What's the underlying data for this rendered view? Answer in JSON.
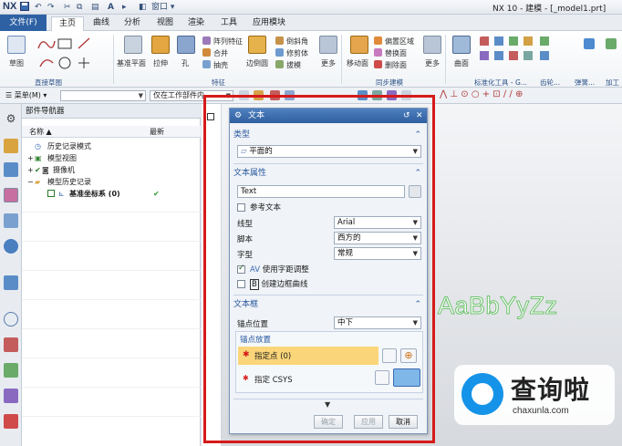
{
  "app": {
    "logo": "NX",
    "title": "NX 10 - 建模 - [_model1.prt]",
    "window_menu": "窗口"
  },
  "tabs": {
    "file": "文件(F)",
    "items": [
      "主页",
      "曲线",
      "分析",
      "视图",
      "渲染",
      "工具",
      "应用模块"
    ],
    "active": "主页"
  },
  "ribbon": {
    "sketch": "草图",
    "direct_sketch_group": "直接草图",
    "datum_plane": "基准平面",
    "extrude": "拉伸",
    "hole": "孔",
    "pattern_feature": "阵列特征",
    "unite": "合并",
    "shell": "抽壳",
    "edge_blend": "边倒圆",
    "chamfer": "倒斜角",
    "trim_body": "修剪体",
    "draft": "拔模",
    "more1": "更多",
    "feature_group": "特征",
    "move_face": "移动面",
    "offset_region": "偏置区域",
    "replace_face": "替换面",
    "delete_face": "删除面",
    "more2": "更多",
    "sync_group": "同步建模",
    "surface": "曲面",
    "standard_tools_group": "标准化工具 - G...",
    "gear_group": "齿轮...",
    "spring_group": "弹簧...",
    "process_group": "加工"
  },
  "toolbar2": {
    "menu_label": "菜单(M)",
    "filter_value": "",
    "scope_value": "仅在工作部件内"
  },
  "navigator": {
    "title": "部件导航器",
    "col_name": "名称",
    "col_latest": "最新",
    "rows": [
      {
        "label": "历史记录模式",
        "check": ""
      },
      {
        "label": "模型视图",
        "check": ""
      },
      {
        "label": "摄像机",
        "check": ""
      },
      {
        "label": "模型历史记录",
        "check": ""
      },
      {
        "label": "基准坐标系 (0)",
        "check": "✔"
      }
    ]
  },
  "dialog": {
    "title": "文本",
    "type_section": "类型",
    "type_value": "平面的",
    "props_section": "文本属性",
    "text_value": "Text",
    "reference_text": "参考文本",
    "font_label": "线型",
    "font_value": "Arial",
    "script_label": "脚本",
    "script_value": "西方的",
    "style_label": "字型",
    "style_value": "常规",
    "kerning": "使用字距调整",
    "outline": "创建边框曲线",
    "box_section": "文本框",
    "anchor_pos_label": "锚点位置",
    "anchor_pos_value": "中下",
    "anchor_placement": "锚点放置",
    "specify_point": "指定点 (0)",
    "specify_csys": "指定 CSYS",
    "ok": "确定",
    "apply": "应用",
    "cancel": "取消"
  },
  "canvas": {
    "sample_text": "AaBbYyZz"
  },
  "watermark": {
    "name": "查询啦",
    "url": "chaxunla.com"
  },
  "colors": {
    "accent": "#2e61a3",
    "highlight_border": "#d61a1a",
    "sample_text_outline": "#6ec26e",
    "watermark_blue": "#1593e8"
  }
}
